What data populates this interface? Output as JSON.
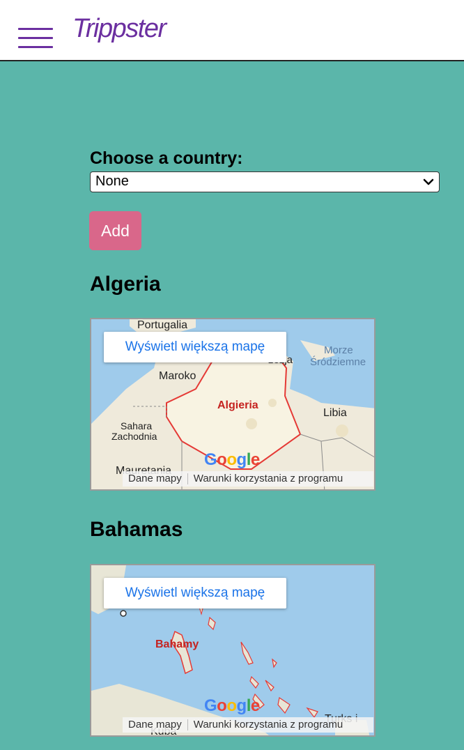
{
  "header": {
    "brand": "Trippster",
    "menu_icon": "hamburger-menu-icon"
  },
  "form": {
    "label": "Choose a country:",
    "selected_value": "None",
    "add_label": "Add"
  },
  "countries": [
    {
      "title": "Algeria",
      "map": {
        "larger_map_label": "Wyświetl większą mapę",
        "labels": {
          "portugal": "Portugalia",
          "tunisia_partial": "zezja",
          "sea_line1": "Morze",
          "sea_line2": "Śródziemne",
          "morocco": "Maroko",
          "highlight": "Algieria",
          "libya": "Libia",
          "western_sahara_line1": "Sahara",
          "western_sahara_line2": "Zachodnia",
          "mauritania": "Mauretania"
        },
        "map_data_label": "Dane mapy",
        "terms_label": "Warunki korzystania z programu"
      }
    },
    {
      "title": "Bahamas",
      "map": {
        "larger_map_label": "Wyświetl większą mapę",
        "labels": {
          "highlight": "Bahamy",
          "turks_partial": "Turks i",
          "cuba_partial": "Kuba"
        },
        "map_data_label": "Dane mapy",
        "terms_label": "Warunki korzystania z programu"
      }
    }
  ],
  "google_logo": [
    "G",
    "o",
    "o",
    "g",
    "l",
    "e"
  ],
  "colors": {
    "background": "#5bb6aa",
    "brand": "#6b2fa0",
    "add_button": "#d9678a",
    "highlight_border": "#e53935"
  }
}
